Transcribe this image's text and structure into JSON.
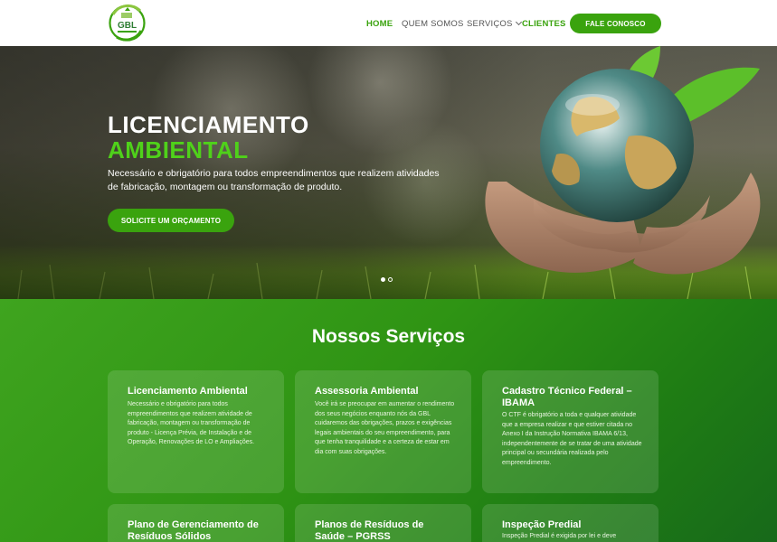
{
  "header": {
    "logo_text": "GBL",
    "nav": {
      "home": "HOME",
      "quem_somos": "QUEM SOMOS",
      "servicos": "SERVIÇOS",
      "clientes": "CLIENTES"
    },
    "cta": "FALE CONOSCO"
  },
  "hero": {
    "title_line1": "LICENCIAMENTO",
    "title_line2": "AMBIENTAL",
    "subtitle": "Necessário e obrigatório para todos empreendimentos que realizem atividades de fabricação, montagem ou transformação de produto.",
    "button": "SOLICITE UM ORÇAMENTO",
    "slides_total": 2,
    "active_slide": 1
  },
  "services": {
    "title": "Nossos Serviços",
    "cards": [
      {
        "title": "Licenciamento Ambiental",
        "text": "Necessário e obrigatório para todos empreendimentos que realizem atividade de fabricação, montagem ou transformação de produto - Licença Prévia, de Instalação e de Operação, Renovações de LO e Ampliações."
      },
      {
        "title": "Assessoria Ambiental",
        "text": "Você irá se preocupar em aumentar o rendimento dos seus negócios enquanto nós da GBL cuidaremos das obrigações, prazos e exigências legais ambientais do seu empreendimento, para que tenha tranquilidade e a certeza de estar em dia com suas obrigações."
      },
      {
        "title": "Cadastro Técnico Federal – IBAMA",
        "text": "O CTF é obrigatório a toda e qualquer atividade que a empresa realizar e que estiver citada no Anexo I da Instrução Normativa IBAMA 6/13, independentemente de se tratar de uma atividade principal ou secundária realizada pelo empreendimento."
      },
      {
        "title": "Plano de Gerenciamento de Resíduos Sólidos",
        "text": ""
      },
      {
        "title": "Planos de Resíduos de Saúde – PGRSS",
        "text": ""
      },
      {
        "title": "Inspeção Predial",
        "text": "Inspeção Predial é exigida por lei e deve"
      }
    ]
  },
  "colors": {
    "brand_green": "#3aa30e",
    "hero_accent": "#4fd11a"
  }
}
